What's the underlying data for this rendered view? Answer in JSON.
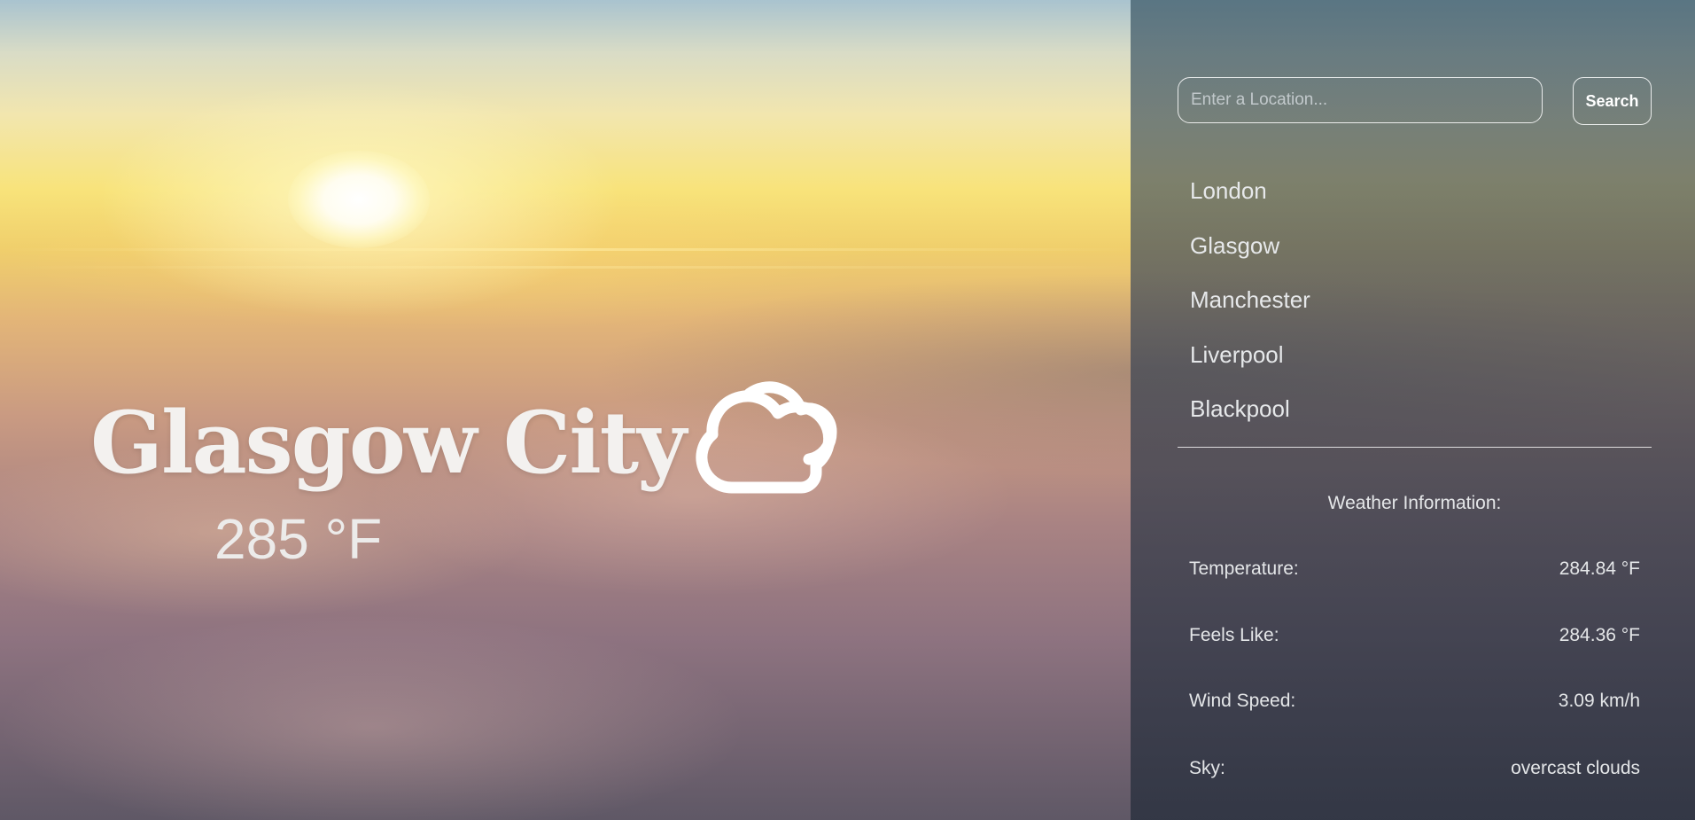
{
  "location": {
    "city_name": "Glasgow City",
    "temperature": "285 °F",
    "condition_icon": "cloudy-icon"
  },
  "search": {
    "placeholder": "Enter a Location...",
    "button_label": "Search"
  },
  "locations": [
    {
      "label": "London"
    },
    {
      "label": "Glasgow"
    },
    {
      "label": "Manchester"
    },
    {
      "label": "Liverpool"
    },
    {
      "label": "Blackpool"
    }
  ],
  "weather_info": {
    "title": "Weather Information:",
    "rows": [
      {
        "label": "Temperature:",
        "value": "284.84 °F"
      },
      {
        "label": "Feels Like:",
        "value": "284.36 °F"
      },
      {
        "label": "Wind Speed:",
        "value": "3.09 km/h"
      },
      {
        "label": "Sky:",
        "value": "overcast clouds"
      }
    ]
  }
}
